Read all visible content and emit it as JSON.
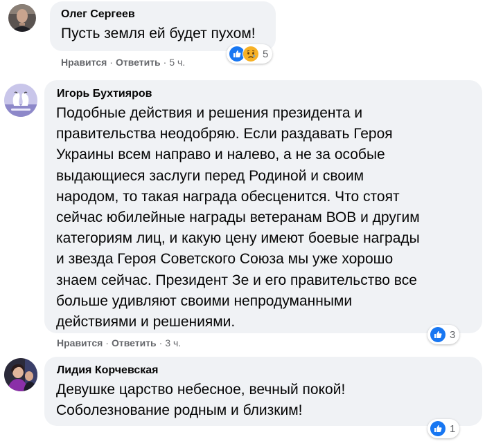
{
  "comments": [
    {
      "author": "Олег Сергеев",
      "lines": [
        "Пусть земля ей будет пухом!"
      ],
      "like_label": "Нравится",
      "reply_label": "Ответить",
      "time": "5 ч.",
      "reactions": [
        "like-icon",
        "sad-icon"
      ],
      "reaction_count": "5"
    },
    {
      "author": "Игорь Бухтияров",
      "lines": [
        "Подобные действия и решения президента и",
        "правительства неодобряю. Если раздавать Героя",
        "Украины всем направо и налево, а не за особые",
        "выдающиеся заслуги перед Родиной и своим",
        "народом, то такая награда обесценится. Что стоят",
        "сейчас юбилейные награды ветеранам ВОВ и другим",
        "категориям лиц, и какую цену имеют боевые награды",
        "и звезда Героя Советского Союза мы уже хорошо",
        "знаем сейчас. Президент Зе и его правительство все",
        "больше удивляют своими непродуманными",
        "действиями и решениями."
      ],
      "like_label": "Нравится",
      "reply_label": "Ответить",
      "time": "3 ч.",
      "reactions": [
        "like-icon"
      ],
      "reaction_count": "3"
    },
    {
      "author": "Лидия Корчевская",
      "lines": [
        "Девушке царство небесное, вечный покой!",
        "Соболезнование родным и близким!"
      ],
      "reactions": [
        "like-icon"
      ],
      "reaction_count": "1"
    }
  ],
  "separator": "·",
  "colors": {
    "bubble": "#f0f2f5",
    "secondary_text": "#65676b",
    "like_blue": "#1877f2",
    "sad_yellow": "#f7b125"
  }
}
